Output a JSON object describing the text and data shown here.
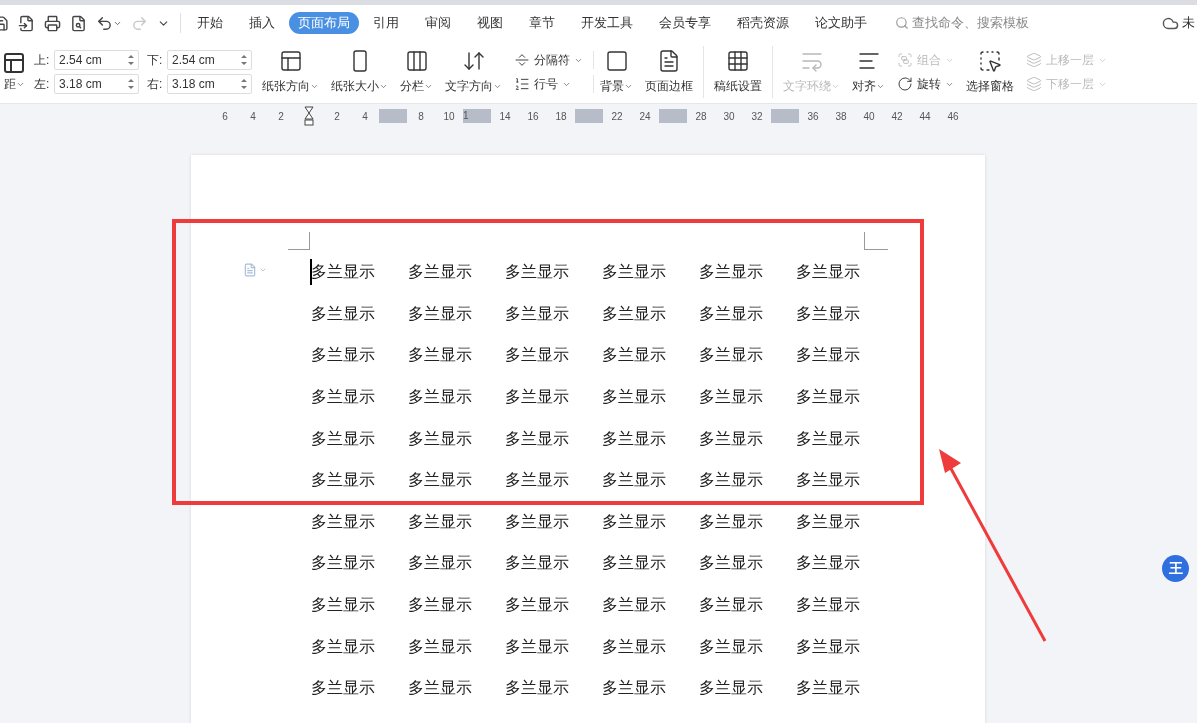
{
  "tabs": [
    {
      "label": "开始",
      "selected": false
    },
    {
      "label": "插入",
      "selected": false
    },
    {
      "label": "页面布局",
      "selected": true
    },
    {
      "label": "引用",
      "selected": false
    },
    {
      "label": "审阅",
      "selected": false
    },
    {
      "label": "视图",
      "selected": false
    },
    {
      "label": "章节",
      "selected": false
    },
    {
      "label": "开发工具",
      "selected": false
    },
    {
      "label": "会员专享",
      "selected": false
    },
    {
      "label": "稻壳资源",
      "selected": false
    },
    {
      "label": "论文助手",
      "selected": false
    }
  ],
  "search": {
    "placeholder": "查找命令、搜索模板"
  },
  "account": {
    "label": "未"
  },
  "ribbon": {
    "margin_button": {
      "label": "距"
    },
    "margins": [
      {
        "label": "上:",
        "value": "2.54 cm"
      },
      {
        "label": "下:",
        "value": "2.54 cm"
      },
      {
        "label": "左:",
        "value": "3.18 cm"
      },
      {
        "label": "右:",
        "value": "3.18 cm"
      }
    ],
    "items": [
      {
        "kind": "big",
        "label": "纸张方向",
        "dropdown": true,
        "disabled": false,
        "separator_after": false
      },
      {
        "kind": "big",
        "label": "纸张大小",
        "dropdown": true,
        "disabled": false,
        "separator_after": false
      },
      {
        "kind": "big",
        "label": "分栏",
        "dropdown": true,
        "disabled": false,
        "separator_after": false
      },
      {
        "kind": "big",
        "label": "文字方向",
        "dropdown": true,
        "disabled": false,
        "separator_after": false
      },
      {
        "kind": "stack",
        "separator_after": true,
        "buttons": [
          {
            "label": "分隔符",
            "dropdown": true,
            "disabled": false
          },
          {
            "label": "行号",
            "dropdown": true,
            "disabled": false
          }
        ]
      },
      {
        "kind": "big",
        "label": "背景",
        "dropdown": true,
        "disabled": false,
        "separator_after": false
      },
      {
        "kind": "big",
        "label": "页面边框",
        "dropdown": false,
        "disabled": false,
        "separator_after": true
      },
      {
        "kind": "big",
        "label": "稿纸设置",
        "dropdown": false,
        "disabled": false,
        "separator_after": true
      },
      {
        "kind": "big",
        "label": "文字环绕",
        "dropdown": true,
        "disabled": true,
        "separator_after": false
      },
      {
        "kind": "big",
        "label": "对齐",
        "dropdown": true,
        "disabled": false,
        "separator_after": false
      },
      {
        "kind": "stack",
        "separator_after": false,
        "buttons": [
          {
            "label": "组合",
            "dropdown": true,
            "disabled": true
          },
          {
            "label": "旋转",
            "dropdown": true,
            "disabled": false
          }
        ]
      },
      {
        "kind": "big",
        "label": "选择窗格",
        "dropdown": false,
        "disabled": false,
        "separator_after": false
      },
      {
        "kind": "stack",
        "separator_after": false,
        "buttons": [
          {
            "label": "上移一层",
            "dropdown": true,
            "disabled": true
          },
          {
            "label": "下移一层",
            "dropdown": true,
            "disabled": true
          }
        ]
      }
    ]
  },
  "ruler": [
    {
      "kind": "number",
      "label": "6"
    },
    {
      "kind": "number",
      "label": "4"
    },
    {
      "kind": "number",
      "label": "2"
    },
    {
      "kind": "indent"
    },
    {
      "kind": "number",
      "label": "2"
    },
    {
      "kind": "number",
      "label": "4"
    },
    {
      "kind": "block"
    },
    {
      "kind": "number",
      "label": "8"
    },
    {
      "kind": "number",
      "label": "10"
    },
    {
      "kind": "block",
      "label": "1"
    },
    {
      "kind": "number",
      "label": "14"
    },
    {
      "kind": "number",
      "label": "16"
    },
    {
      "kind": "number",
      "label": "18"
    },
    {
      "kind": "block"
    },
    {
      "kind": "number",
      "label": "22"
    },
    {
      "kind": "number",
      "label": "24"
    },
    {
      "kind": "block"
    },
    {
      "kind": "number",
      "label": "28"
    },
    {
      "kind": "number",
      "label": "30"
    },
    {
      "kind": "number",
      "label": "32"
    },
    {
      "kind": "block"
    },
    {
      "kind": "number",
      "label": "36"
    },
    {
      "kind": "number",
      "label": "38"
    },
    {
      "kind": "number",
      "label": "40"
    },
    {
      "kind": "number",
      "label": "42"
    },
    {
      "kind": "number",
      "label": "44"
    },
    {
      "kind": "number",
      "label": "46"
    }
  ],
  "document": {
    "rows": [
      [
        "多兰显示",
        "多兰显示",
        "多兰显示",
        "多兰显示",
        "多兰显示",
        "多兰显示"
      ],
      [
        "多兰显示",
        "多兰显示",
        "多兰显示",
        "多兰显示",
        "多兰显示",
        "多兰显示"
      ],
      [
        "多兰显示",
        "多兰显示",
        "多兰显示",
        "多兰显示",
        "多兰显示",
        "多兰显示"
      ],
      [
        "多兰显示",
        "多兰显示",
        "多兰显示",
        "多兰显示",
        "多兰显示",
        "多兰显示"
      ],
      [
        "多兰显示",
        "多兰显示",
        "多兰显示",
        "多兰显示",
        "多兰显示",
        "多兰显示"
      ],
      [
        "多兰显示",
        "多兰显示",
        "多兰显示",
        "多兰显示",
        "多兰显示",
        "多兰显示"
      ],
      [
        "多兰显示",
        "多兰显示",
        "多兰显示",
        "多兰显示",
        "多兰显示",
        "多兰显示"
      ],
      [
        "多兰显示",
        "多兰显示",
        "多兰显示",
        "多兰显示",
        "多兰显示",
        "多兰显示"
      ],
      [
        "多兰显示",
        "多兰显示",
        "多兰显示",
        "多兰显示",
        "多兰显示",
        "多兰显示"
      ],
      [
        "多兰显示",
        "多兰显示",
        "多兰显示",
        "多兰显示",
        "多兰显示",
        "多兰显示"
      ],
      [
        "多兰显示",
        "多兰显示",
        "多兰显示",
        "多兰显示",
        "多兰显示",
        "多兰显示"
      ]
    ]
  },
  "side_badge": {
    "label": "王"
  }
}
